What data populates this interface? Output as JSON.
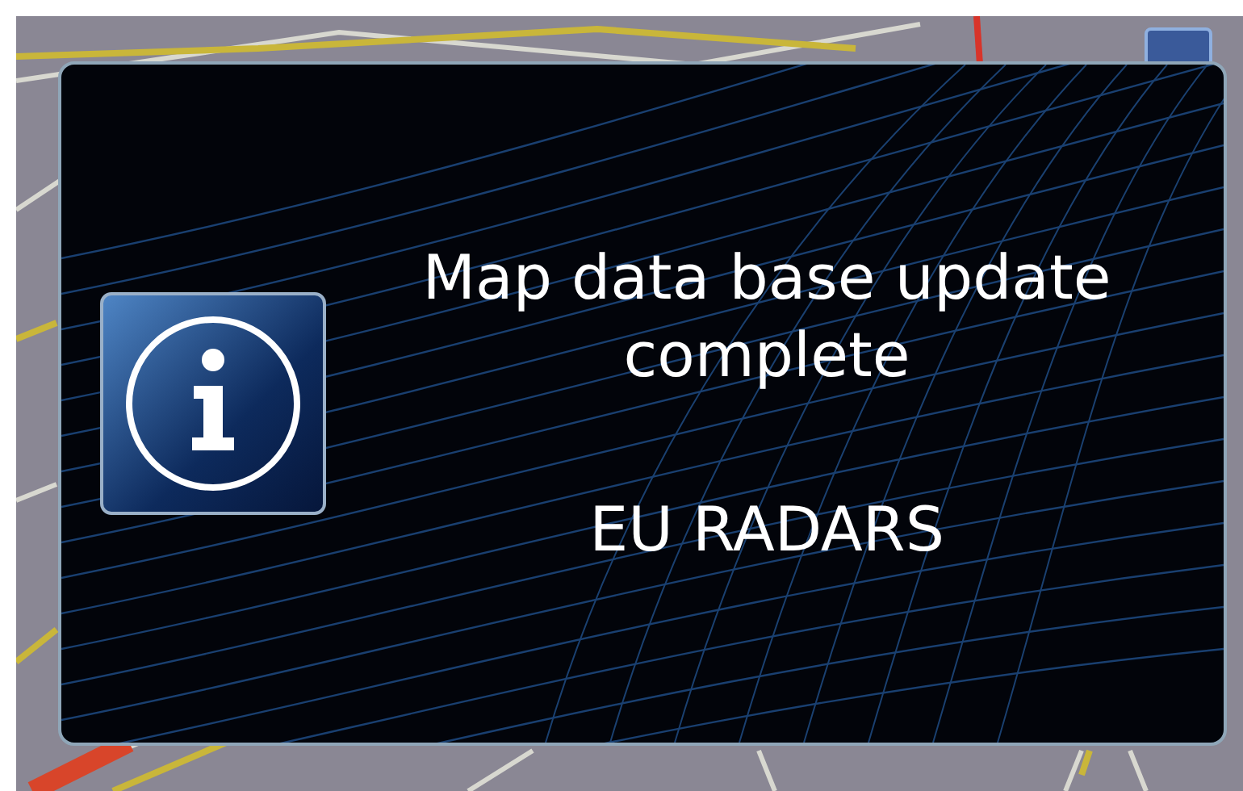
{
  "dialog": {
    "lines": [
      "Map data base update",
      "complete"
    ],
    "detail": "EU RADARS"
  }
}
